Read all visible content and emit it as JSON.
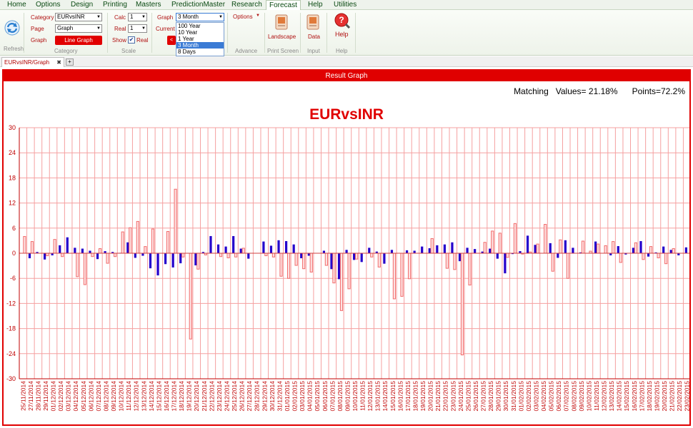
{
  "menu": [
    "Home",
    "Options",
    "Design",
    "Printing",
    "Masters",
    "PredictionMaster",
    "Research",
    "Forecast",
    "Help",
    "Utilities"
  ],
  "ribbon": {
    "refresh_label": "Refresh",
    "category_label": "Category",
    "category_value": "EURvsINR",
    "page_label": "Page",
    "page_value": "Graph",
    "graph_label": "Graph",
    "graph_button": "Line Graph",
    "category_group": "Category",
    "calc_label": "Calc",
    "calc_value": "1",
    "real_label": "Real",
    "real_value": "1",
    "show_label": "Show",
    "show_real_label": "Real",
    "scale_group": "Scale",
    "graph2_label": "Graph",
    "graph2_value": "3 Month",
    "current_label": "Current",
    "graph_options": [
      "100 Year",
      "10 Year",
      "1 Year",
      "3 Month",
      "8 Days"
    ],
    "graph_options_selected": "3 Month",
    "options_label": "Options",
    "advance_group": "Advance",
    "landscape_label": "Landscape",
    "print_group": "Print Screen",
    "data_label": "Data",
    "input_group": "Input",
    "help_label": "Help",
    "help_group": "Help"
  },
  "tab": {
    "label": "EURvsINR/Graph",
    "close": "✖",
    "add": "+"
  },
  "panel": {
    "header": "Result Graph",
    "matching": "Matching   Values= 21.18%      Points=72.2%"
  },
  "colors": {
    "accent": "#e00000",
    "calc_bar": "#2400cc",
    "real_bar": "#f26b6b",
    "grid": "#f5a0a0"
  },
  "chart_data": {
    "type": "bar",
    "title": "EURvsINR",
    "ylim": [
      -30,
      30
    ],
    "yticks": [
      30,
      24,
      18,
      12,
      6,
      0,
      -6,
      -12,
      -18,
      -24,
      -30
    ],
    "categories": [
      "25/11/2014",
      "27/11/2014",
      "28/11/2014",
      "29/11/2014",
      "01/12/2014",
      "02/12/2014",
      "03/12/2014",
      "04/12/2014",
      "05/12/2014",
      "06/12/2014",
      "07/12/2014",
      "08/12/2014",
      "09/12/2014",
      "10/12/2014",
      "11/12/2014",
      "12/12/2014",
      "13/12/2014",
      "14/12/2014",
      "15/12/2014",
      "16/12/2014",
      "17/12/2014",
      "18/12/2014",
      "19/12/2014",
      "20/12/2014",
      "21/12/2014",
      "22/12/2014",
      "23/12/2014",
      "24/12/2014",
      "25/12/2014",
      "26/12/2014",
      "27/12/2014",
      "28/12/2014",
      "29/12/2014",
      "30/12/2014",
      "31/12/2014",
      "01/01/2015",
      "02/01/2015",
      "03/01/2015",
      "04/01/2015",
      "05/01/2015",
      "06/01/2015",
      "07/01/2015",
      "08/01/2015",
      "09/01/2015",
      "10/01/2015",
      "11/01/2015",
      "12/01/2015",
      "13/01/2015",
      "14/01/2015",
      "15/01/2015",
      "16/01/2015",
      "17/01/2015",
      "18/01/2015",
      "19/01/2015",
      "20/01/2015",
      "21/01/2015",
      "22/01/2015",
      "23/01/2015",
      "24/01/2015",
      "25/01/2015",
      "26/01/2015",
      "27/01/2015",
      "28/01/2015",
      "29/01/2015",
      "30/01/2015",
      "31/01/2015",
      "01/02/2015",
      "02/02/2015",
      "03/02/2015",
      "04/02/2015",
      "05/02/2015",
      "06/02/2015",
      "07/02/2015",
      "08/02/2015",
      "09/02/2015",
      "10/02/2015",
      "11/02/2015",
      "12/02/2015",
      "13/02/2015",
      "14/02/2015",
      "15/02/2015",
      "16/02/2015",
      "17/02/2015",
      "18/02/2015",
      "19/02/2015",
      "20/02/2015",
      "21/02/2015",
      "22/02/2015",
      "23/02/2015"
    ],
    "series": [
      {
        "values": [
          0,
          -1.2,
          0.3,
          -1.5,
          -0.5,
          1.9,
          3.8,
          1.3,
          1.1,
          0.6,
          -1.4,
          0.5,
          0.3,
          0.1,
          2.6,
          -1.1,
          -0.6,
          -3.6,
          -5.3,
          -2.6,
          -3.4,
          -2.4,
          0,
          -2.9,
          0.3,
          4.1,
          2.1,
          1.6,
          4.1,
          1.1,
          -1.3,
          0,
          2.8,
          1.8,
          3.1,
          2.9,
          2.1,
          -1.2,
          -0.6,
          0,
          0.6,
          -3.8,
          -6.2,
          0.8,
          -1.6,
          -2.1,
          1.3,
          0.4,
          -2.5,
          0.8,
          0,
          0.7,
          0.6,
          1.6,
          1.2,
          1.9,
          2.1,
          2.6,
          -1.9,
          1.3,
          1,
          0.4,
          1.1,
          -1.3,
          -4.8,
          -0.2,
          0.5,
          4.2,
          2,
          0,
          2.4,
          -1.1,
          3.1,
          1.3,
          0.2,
          0,
          2.8,
          0,
          -0.5,
          1.7,
          -0.3,
          1.3,
          2.9,
          -0.8,
          0.2,
          1.6,
          0.8,
          -0.5,
          1.4,
          0.8
        ]
      },
      {
        "values": [
          4,
          2.8,
          0,
          -0.6,
          3.3,
          -0.8,
          0,
          -5.6,
          -7.5,
          -0.8,
          1.1,
          -2.4,
          -0.8,
          5.1,
          6.1,
          7.6,
          1.6,
          5.8,
          0,
          5.2,
          15.3,
          -0.9,
          -20.5,
          -3.8,
          -0.4,
          0,
          -0.8,
          -1.1,
          -0.9,
          1.2,
          0,
          0,
          -0.6,
          -0.9,
          -5.5,
          -6,
          -2.9,
          -3.7,
          -4.5,
          0,
          -2.9,
          -7.1,
          -13.7,
          -8.5,
          -1.4,
          0,
          -0.9,
          -3.3,
          0,
          -10.9,
          -10.3,
          -6.1,
          0,
          0,
          3.5,
          0,
          -3.6,
          -3.9,
          -24.3,
          -7.6,
          0,
          2.6,
          5.3,
          4.8,
          -1,
          7.1,
          -0.2,
          0.3,
          2.2,
          6.9,
          -4.3,
          3.2,
          -6,
          0,
          2.9,
          0.5,
          2.2,
          1.8,
          2.8,
          -2.2,
          0,
          2.5,
          -1.5,
          1.6,
          -1.1,
          -2.5,
          1.1,
          0
        ]
      }
    ]
  }
}
